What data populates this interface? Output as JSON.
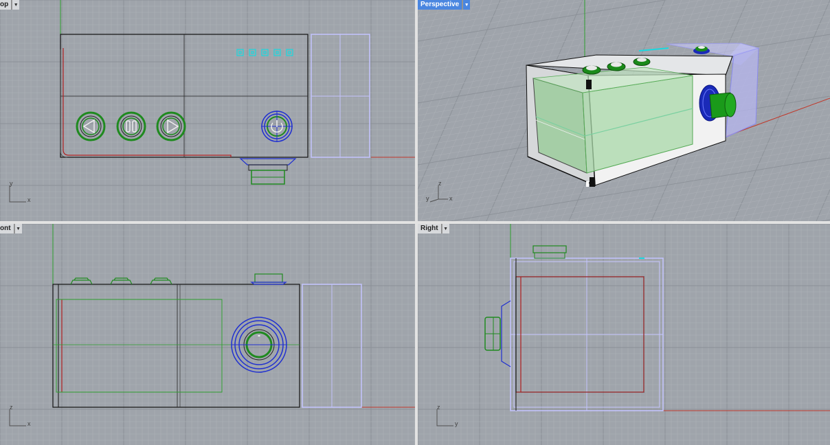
{
  "viewports": {
    "top": {
      "label": "Top",
      "shown_label": "op",
      "axes": [
        "y",
        "x"
      ]
    },
    "perspective": {
      "label": "Perspective",
      "axes": [
        "z",
        "y",
        "x"
      ]
    },
    "front": {
      "label": "Front",
      "shown_label": "ont",
      "axes": [
        "z",
        "x"
      ]
    },
    "right": {
      "label": "Right",
      "axes": [
        "z",
        "y"
      ]
    }
  },
  "colors": {
    "viewport_bg": "#9fa4ab",
    "grid_minor": "#aeb2b8",
    "grid_major": "#8b9097",
    "x_axis": "#c0392b",
    "y_axis": "#2e9e2e",
    "active_label": "#4a86e0",
    "selection": "#b9b9ff",
    "button_green": "#1f8a1f",
    "power_blue": "#2030d0",
    "led_cyan": "#1ad9e0"
  }
}
